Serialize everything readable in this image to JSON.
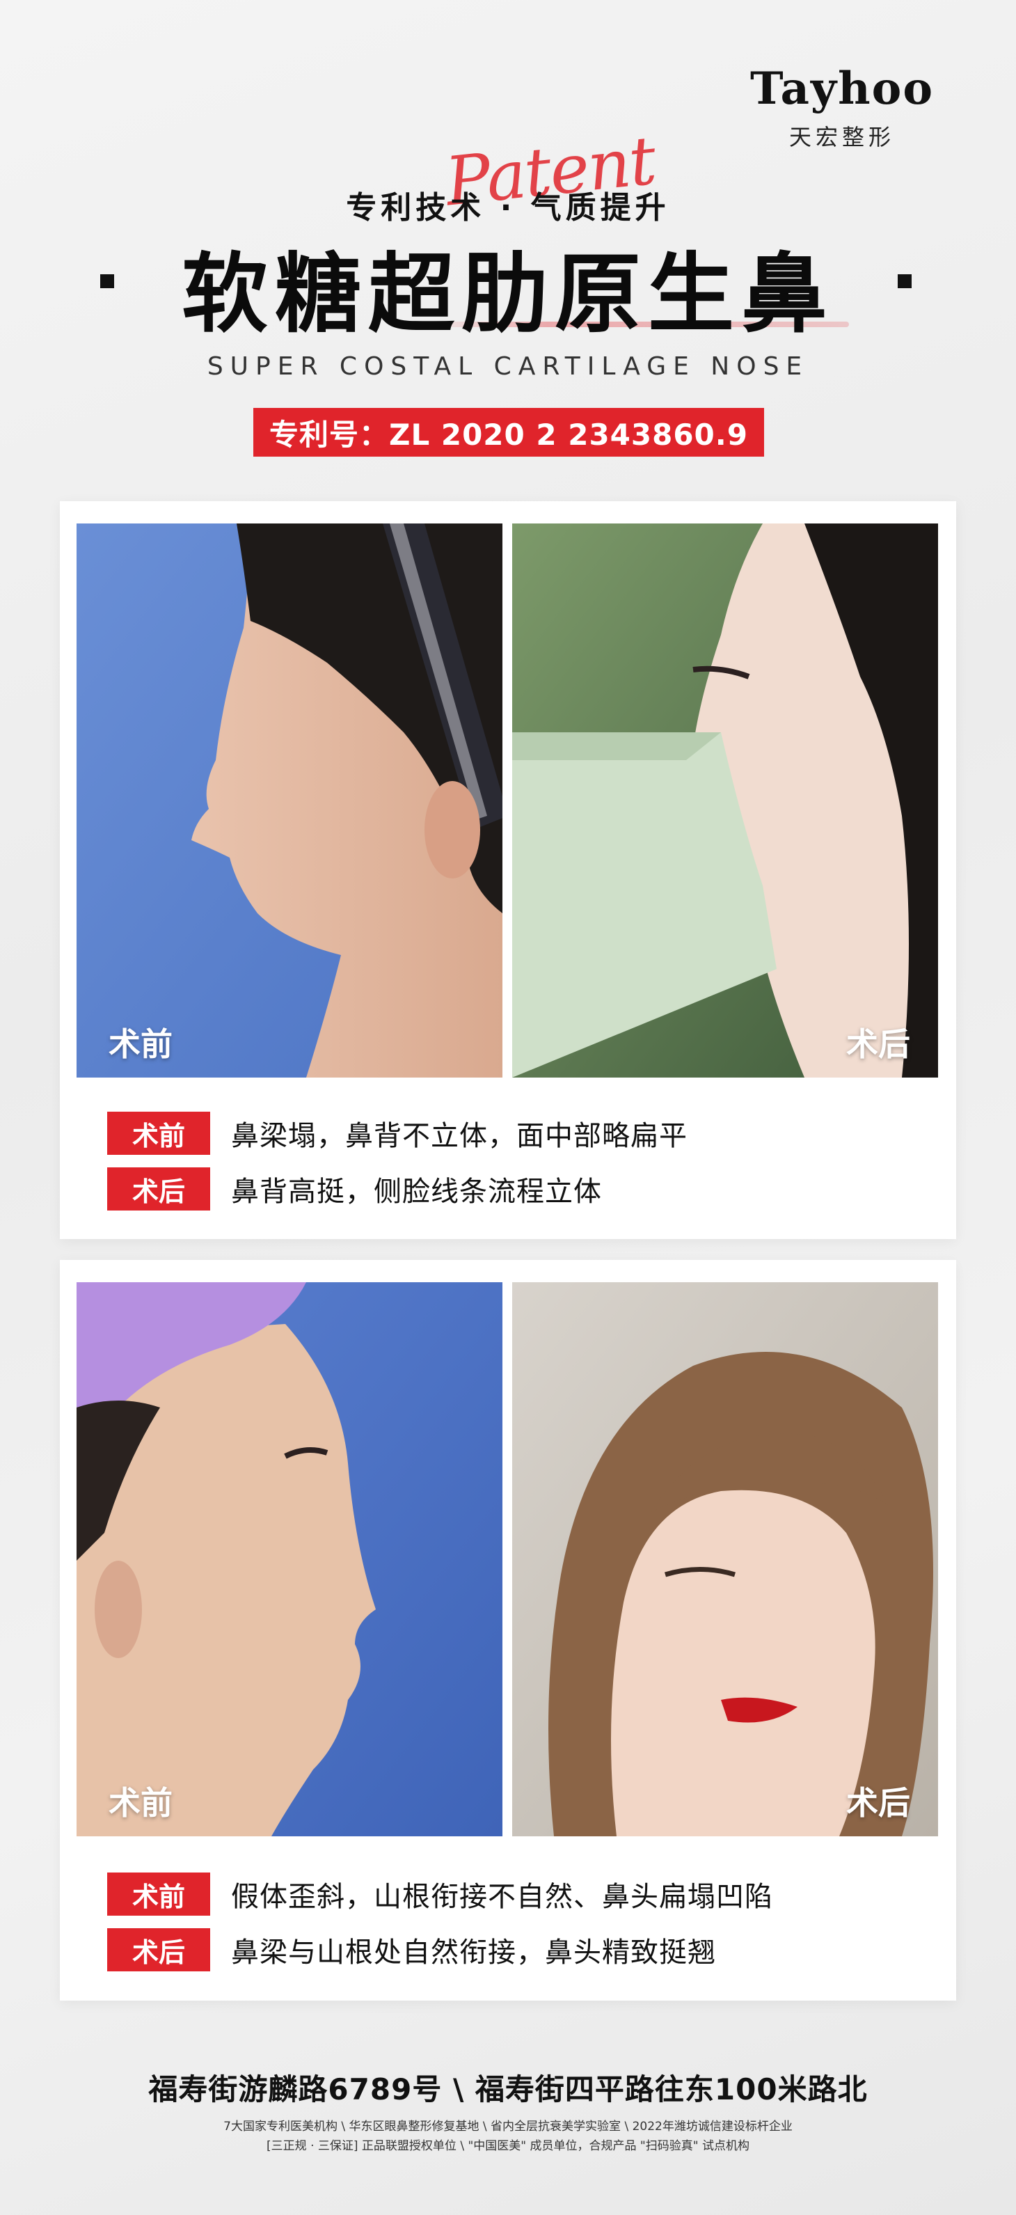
{
  "brand": {
    "name": "Tayhoo",
    "sub": "天宏整形"
  },
  "header": {
    "tagline": "专利技术 · 气质提升",
    "script_word": "Patent",
    "title": "软糖超肋原生鼻",
    "english": "SUPER COSTAL  CARTILAGE NOSE",
    "patent": "专利号：ZL 2020 2 2343860.9"
  },
  "cases": [
    {
      "before_label": "术前",
      "after_label": "术后",
      "rows": [
        {
          "tag": "术前",
          "text": "鼻梁塌，鼻背不立体，面中部略扁平"
        },
        {
          "tag": "术后",
          "text": "鼻背高挺，侧脸线条流程立体"
        }
      ]
    },
    {
      "before_label": "术前",
      "after_label": "术后",
      "rows": [
        {
          "tag": "术前",
          "text": "假体歪斜，山根衔接不自然、鼻头扁塌凹陷"
        },
        {
          "tag": "术后",
          "text": "鼻梁与山根处自然衔接，鼻头精致挺翘"
        }
      ]
    }
  ],
  "footer": {
    "address": "福寿街游麟路6789号 \\ 福寿街四平路往东100米路北",
    "fine1": "7大国家专利医美机构 \\ 华东区眼鼻整形修复基地 \\ 省内全层抗衰美学实验室 \\ 2022年潍坊诚信建设标杆企业",
    "fine2": "[三正规 · 三保证] 正品联盟授权单位 \\ \"中国医美\" 成员单位，合规产品 \"扫码验真\" 试点机构"
  },
  "colors": {
    "accent": "#e0242b",
    "text": "#111111",
    "background": "#efefef"
  }
}
